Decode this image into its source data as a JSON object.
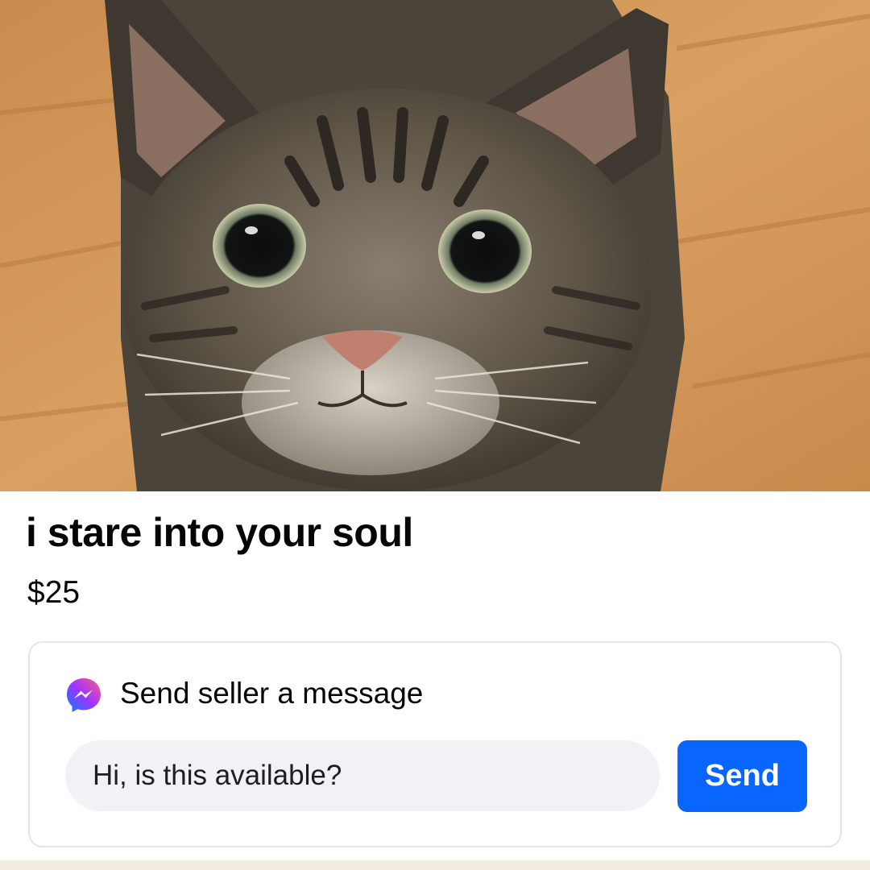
{
  "listing": {
    "photo_subject": "tabby-cat-photo",
    "title": "i stare into your soul",
    "price": "$25"
  },
  "message_card": {
    "icon": "messenger-icon",
    "heading": "Send seller a message",
    "input_value": "Hi, is this available?",
    "send_label": "Send"
  },
  "colors": {
    "send_button": "#0866ff",
    "input_background": "#f0f2f5",
    "card_border": "#e4e6eb",
    "text": "#050505"
  }
}
